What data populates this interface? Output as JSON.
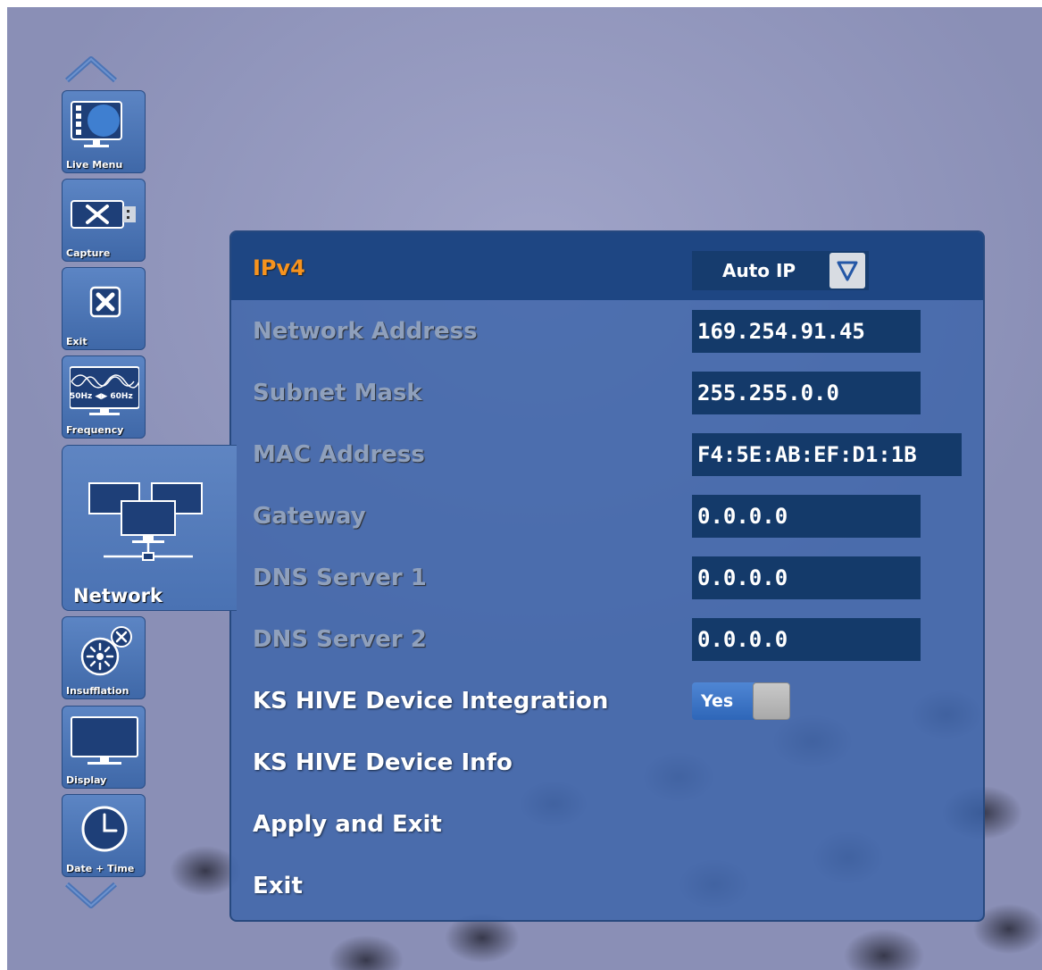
{
  "sidebar": {
    "items": [
      {
        "label": "Live Menu",
        "icon": "live-menu-monitor-icon"
      },
      {
        "label": "Capture",
        "icon": "capture-usb-tools-icon"
      },
      {
        "label": "Exit",
        "icon": "exit-x-icon"
      },
      {
        "label": "Frequency",
        "icon": "frequency-wave-icon",
        "icon_text": "50Hz ◀▶ 60Hz"
      },
      {
        "label": "Network",
        "icon": "network-monitors-icon",
        "active": true
      },
      {
        "label": "Insufflation",
        "icon": "insufflation-icon"
      },
      {
        "label": "Display",
        "icon": "display-monitor-icon"
      },
      {
        "label": "Date + Time",
        "icon": "clock-icon"
      }
    ],
    "scroll_up_icon": "chevron-up-icon",
    "scroll_down_icon": "chevron-down-icon"
  },
  "panel": {
    "header": {
      "label": "IPv4",
      "dropdown_value": "Auto IP",
      "dropdown_icon": "triangle-down-icon"
    },
    "rows": [
      {
        "label": "Network Address",
        "value": "169.254.91.45"
      },
      {
        "label": "Subnet Mask",
        "value": "255.255.0.0"
      },
      {
        "label": "MAC Address",
        "value": "F4:5E:AB:EF:D1:1B"
      },
      {
        "label": "Gateway",
        "value": "0.0.0.0"
      },
      {
        "label": "DNS Server 1",
        "value": "0.0.0.0"
      },
      {
        "label": "DNS Server 2",
        "value": "0.0.0.0"
      }
    ],
    "integration": {
      "label": "KS HIVE Device Integration",
      "toggle_value": "Yes"
    },
    "device_info": {
      "label": "KS HIVE Device Info"
    },
    "apply_exit": {
      "label": "Apply and Exit"
    },
    "exit": {
      "label": "Exit"
    }
  },
  "colors": {
    "panel_bg": "#3c64aa",
    "header_bg": "#1e4683",
    "field_bg": "#143a6a",
    "accent_orange": "#f7931e",
    "disabled_label": "#8fa0bc"
  }
}
